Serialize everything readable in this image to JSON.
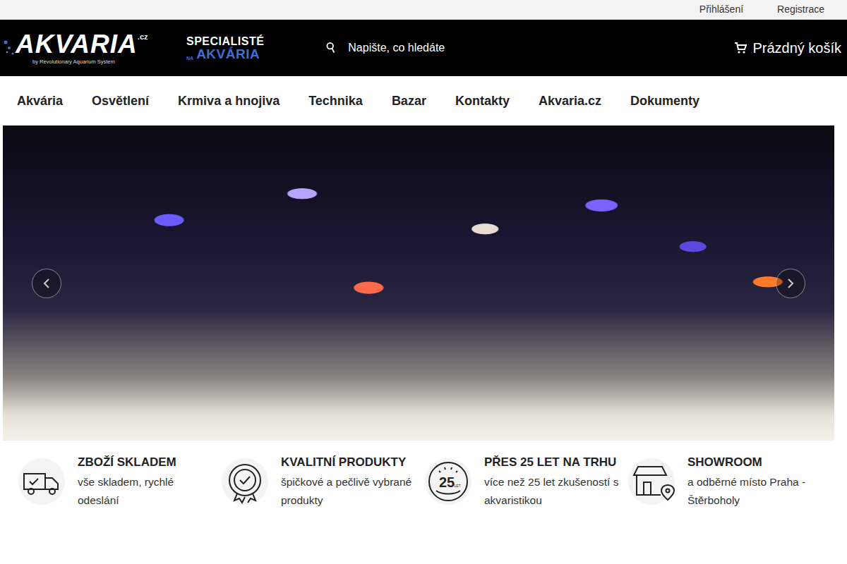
{
  "topbar": {
    "links": [
      "Přihlášení",
      "Registrace"
    ]
  },
  "header": {
    "logo": {
      "name": "AKVARIA",
      "tld": ".cz",
      "subtitle": "by Revolutionary Aquarium System"
    },
    "tagline": {
      "top": "SPECIALISTÉ",
      "small": "NA",
      "bottom": "AKVÁRIA"
    },
    "search": {
      "placeholder": "Napište, co hledáte"
    },
    "cart": {
      "label": "Prázdný košík"
    }
  },
  "nav": {
    "items": [
      "Akvária",
      "Osvětlení",
      "Krmiva a hnojiva",
      "Technika",
      "Bazar",
      "Kontakty",
      "Akvaria.cz",
      "Dokumenty"
    ]
  },
  "features": [
    {
      "kind": "truck",
      "title": "ZBOŽÍ SKLADEM",
      "text": "vše skladem, rychlé odeslání"
    },
    {
      "kind": "quality",
      "title": "KVALITNÍ PRODUKTY",
      "text": "špičkové a pečlivě vybrané produkty"
    },
    {
      "kind": "years",
      "title": "PŘES 25 LET NA TRHU",
      "text": "více než 25 let zkušeností s akvaristikou",
      "icon_number": "25",
      "icon_unit": "LET"
    },
    {
      "kind": "shop",
      "title": "SHOWROOM",
      "text": "a odběrné místo Praha - Štěrboholy"
    }
  ]
}
